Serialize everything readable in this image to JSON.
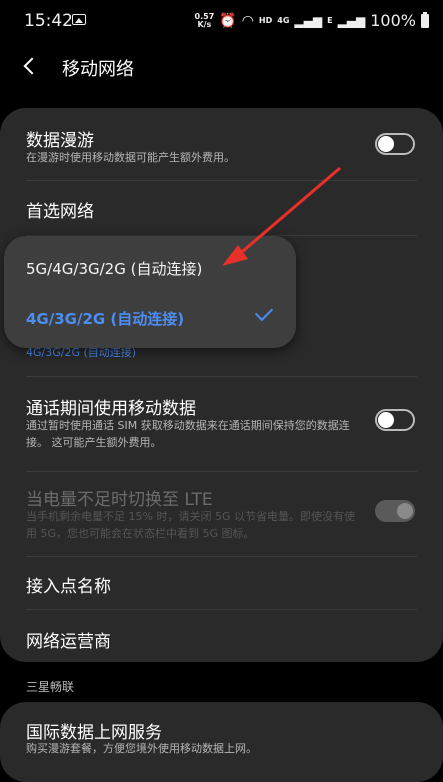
{
  "status_bar": {
    "time": "15:42",
    "net_speed_value": "0.57",
    "net_speed_unit": "K/s",
    "network_label": "HD",
    "signal_4g": "4G",
    "signal_e": "E",
    "battery": "100%"
  },
  "header": {
    "title": "移动网络"
  },
  "rows": {
    "roaming": {
      "title": "数据漫游",
      "sub": "在漫游时使用移动数据可能产生额外费用。",
      "toggle_on": false
    },
    "preferred": {
      "title": "首选网络"
    },
    "preferred_value": "4G/3G/2G (自动连接)",
    "call_data": {
      "title": "通话期间使用移动数据",
      "sub": "通过暂时使用通话 SIM 获取移动数据来在通话期间保持您的数据连接。 这可能产生额外费用。",
      "toggle_on": false
    },
    "low_battery": {
      "title": "当电量不足时切换至 LTE",
      "sub": "当手机剩余电量不足 15% 时，请关闭 5G 以节省电量。即使没有使用 5G，您也可能会在状态栏中看到 5G 图标。",
      "toggle_on": true
    },
    "apn": {
      "title": "接入点名称"
    },
    "carrier": {
      "title": "网络运营商"
    }
  },
  "section_label": "三星畅联",
  "card2": {
    "title": "国际数据上网服务",
    "sub": "购买漫游套餐，方便您境外使用移动数据上网。"
  },
  "popup": {
    "options": [
      "5G/4G/3G/2G (自动连接)",
      "4G/3G/2G (自动连接)"
    ],
    "selected_index": 1
  },
  "colors": {
    "accent": "#4b8ef5",
    "arrow": "#e8302a",
    "card": "#2a2a2a"
  }
}
